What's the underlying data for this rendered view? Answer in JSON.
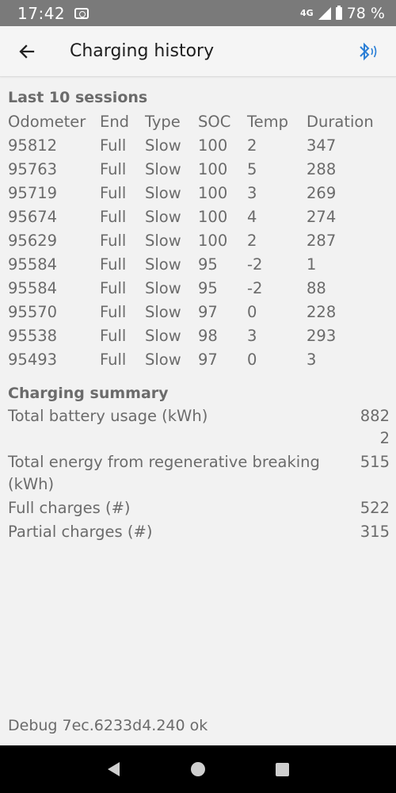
{
  "status_bar": {
    "time": "17:42",
    "network": "4G",
    "battery": "78 %"
  },
  "app_bar": {
    "title": "Charging history"
  },
  "sessions": {
    "title": "Last 10 sessions",
    "headers": [
      "Odometer",
      "End",
      "Type",
      "SOC",
      "Temp",
      "Duration"
    ],
    "rows": [
      [
        "95812",
        "Full",
        "Slow",
        "100",
        "2",
        "347"
      ],
      [
        "95763",
        "Full",
        "Slow",
        "100",
        "5",
        "288"
      ],
      [
        "95719",
        "Full",
        "Slow",
        "100",
        "3",
        "269"
      ],
      [
        "95674",
        "Full",
        "Slow",
        "100",
        "4",
        "274"
      ],
      [
        "95629",
        "Full",
        "Slow",
        "100",
        "2",
        "287"
      ],
      [
        "95584",
        "Full",
        "Slow",
        "95",
        "-2",
        "1"
      ],
      [
        "95584",
        "Full",
        "Slow",
        "95",
        "-2",
        "88"
      ],
      [
        "95570",
        "Full",
        "Slow",
        "97",
        "0",
        "228"
      ],
      [
        "95538",
        "Full",
        "Slow",
        "98",
        "3",
        "293"
      ],
      [
        "95493",
        "Full",
        "Slow",
        "97",
        "0",
        "3"
      ]
    ]
  },
  "summary": {
    "title": "Charging summary",
    "items": [
      {
        "label": "Total battery usage (kWh)",
        "value": "8822"
      },
      {
        "label": "Total energy from regenerative breaking (kWh)",
        "value": "515"
      },
      {
        "label": "Full charges (#)",
        "value": "522"
      },
      {
        "label": "Partial charges (#)",
        "value": "315"
      }
    ]
  },
  "debug": "Debug 7ec.6233d4.240 ok",
  "colors": {
    "bluetooth": "#2b7fd6",
    "status_bar": "#7a7a7a",
    "nav_bar": "#000000"
  },
  "icons": {
    "back": "arrow-left-icon",
    "bluetooth": "bluetooth-icon",
    "camera": "screenshot-icon"
  }
}
